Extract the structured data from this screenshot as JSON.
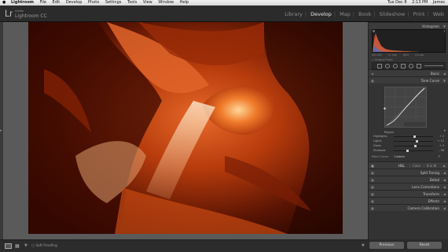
{
  "menubar": {
    "apple_icon": "apple-icon",
    "app": "Lightroom",
    "menus": [
      "File",
      "Edit",
      "Develop",
      "Photo",
      "Settings",
      "Tools",
      "View",
      "Window",
      "Help"
    ],
    "status": [
      "Tue Dec 8",
      "2:13 PM",
      "James"
    ]
  },
  "identity": {
    "logo": "Lr",
    "brand_small": "Adobe",
    "brand": "Lightroom CC"
  },
  "modules": [
    "Library",
    "Develop",
    "Map",
    "Book",
    "Slideshow",
    "Print",
    "Web"
  ],
  "active_module": "Develop",
  "right_panel": {
    "histogram_title": "Histogram",
    "histogram_info": [
      "ISO 100",
      "17 mm",
      "f/8.0",
      "2.0 sec"
    ],
    "original_photo": "Original Photo",
    "basic": "Basic",
    "tone_curve": "Tone Curve",
    "region": "Region",
    "sliders": [
      {
        "label": "Highlights",
        "value": "+ 2"
      },
      {
        "label": "Lights",
        "value": "+ 10"
      },
      {
        "label": "Darks",
        "value": "+ 4"
      },
      {
        "label": "Shadows",
        "value": "- 36"
      }
    ],
    "point_curve_label": "Point Curve :",
    "point_curve_value": "Custom",
    "hsl_tabs": [
      "HSL",
      "Color",
      "B & W"
    ],
    "sections": [
      "Split Toning",
      "Detail",
      "Lens Corrections",
      "Transform",
      "Effects",
      "Camera Calibration"
    ],
    "previous": "Previous",
    "reset": "Reset"
  },
  "toolbar": {
    "status": "Soft Proofing"
  },
  "colors": {
    "accent_active": "#e6e6e6",
    "panel": "#333333",
    "photo_main": "#c2410b"
  }
}
